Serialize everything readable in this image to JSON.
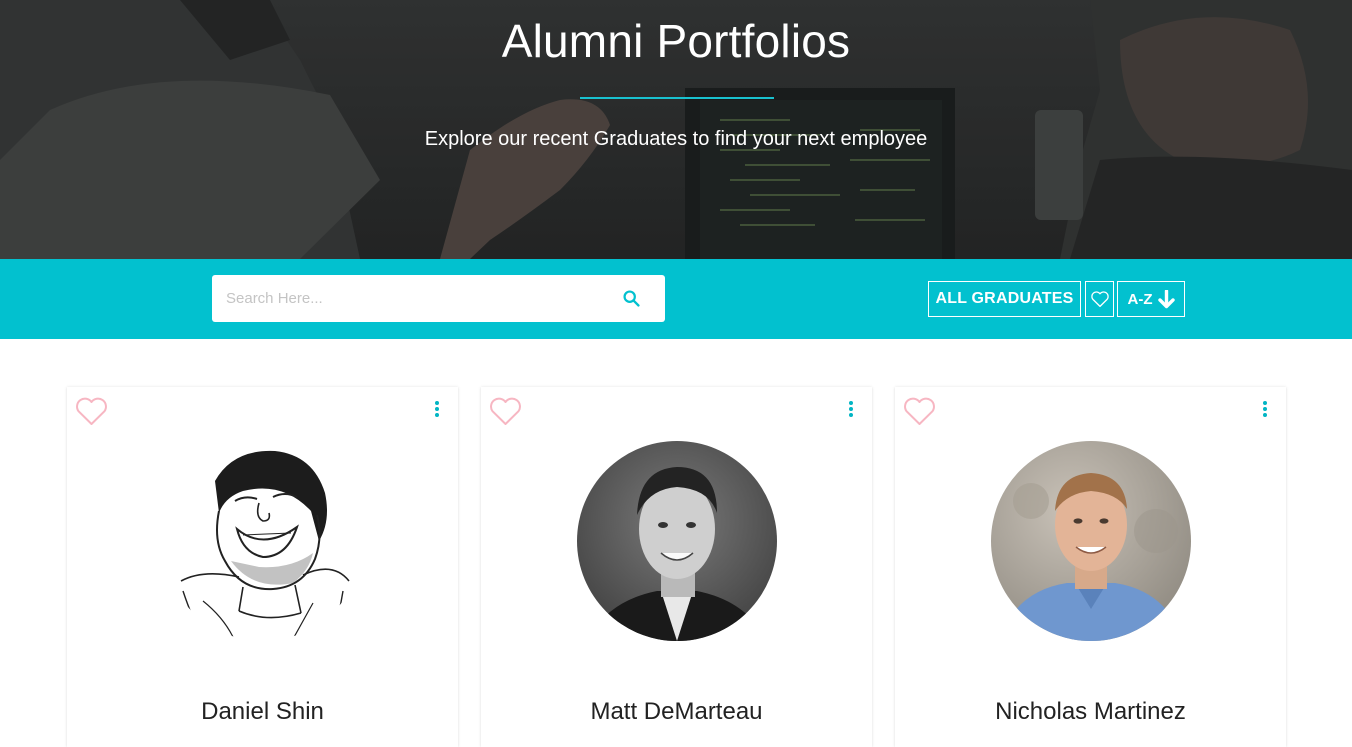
{
  "hero": {
    "title": "Alumni Portfolios",
    "subtitle": "Explore our recent Graduates to find your next employee"
  },
  "toolbar": {
    "search_placeholder": "Search Here...",
    "search_value": "",
    "filter_all_label": "ALL GRADUATES",
    "sort_label": "A-Z",
    "accent_color": "#02c1cf"
  },
  "icons": {
    "search": "search-icon",
    "favorites": "heart-outline-icon",
    "sort": "arrow-down-icon",
    "card_favorite": "heart-outline-icon",
    "card_menu": "kebab-menu-icon"
  },
  "graduates": [
    {
      "name": "Daniel Shin",
      "avatar": "laughing-cartoon-drawing"
    },
    {
      "name": "Matt DeMarteau",
      "avatar": "black-and-white-headshot"
    },
    {
      "name": "Nicholas Martinez",
      "avatar": "color-headshot-blue-shirt"
    }
  ]
}
